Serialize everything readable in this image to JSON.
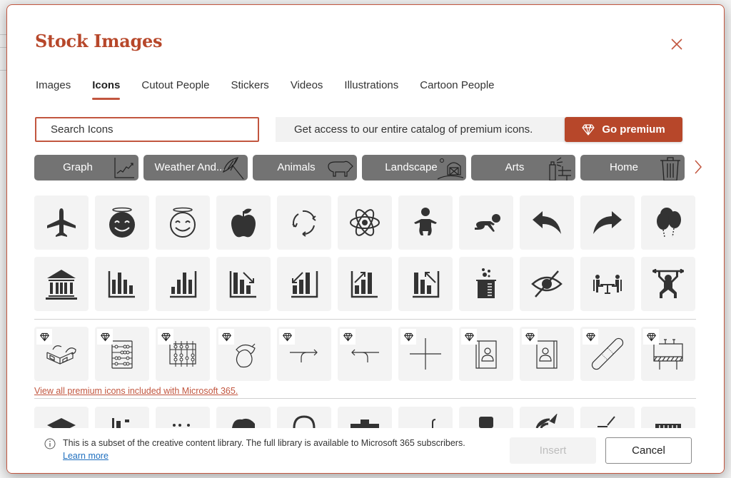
{
  "dialog": {
    "title": "Stock Images",
    "close_label": "Close"
  },
  "tabs": [
    {
      "label": "Images",
      "active": false
    },
    {
      "label": "Icons",
      "active": true
    },
    {
      "label": "Cutout People",
      "active": false
    },
    {
      "label": "Stickers",
      "active": false
    },
    {
      "label": "Videos",
      "active": false
    },
    {
      "label": "Illustrations",
      "active": false
    },
    {
      "label": "Cartoon People",
      "active": false
    }
  ],
  "search": {
    "placeholder": "Search Icons",
    "value": ""
  },
  "promo": {
    "text": "Get access to our entire catalog of premium icons.",
    "button_label": "Go premium",
    "button_icon": "diamond-icon"
  },
  "categories": [
    {
      "label": "Graph",
      "icon": "line-graph-icon"
    },
    {
      "label": "Weather And...",
      "icon": "umbrella-icon"
    },
    {
      "label": "Animals",
      "icon": "pig-icon"
    },
    {
      "label": "Landscape",
      "icon": "barn-icon"
    },
    {
      "label": "Arts",
      "icon": "spray-paint-icon"
    },
    {
      "label": "Home",
      "icon": "trash-can-icon"
    }
  ],
  "free_icons": [
    [
      {
        "name": "airplane"
      },
      {
        "name": "smiling-face-with-halo-filled"
      },
      {
        "name": "smiling-face-with-halo-outline"
      },
      {
        "name": "apple"
      },
      {
        "name": "refresh-arrows"
      },
      {
        "name": "atom"
      },
      {
        "name": "baby"
      },
      {
        "name": "crawling-baby"
      },
      {
        "name": "reply-arrow"
      },
      {
        "name": "forward-arrow"
      },
      {
        "name": "balloons"
      }
    ],
    [
      {
        "name": "bank"
      },
      {
        "name": "bar-chart"
      },
      {
        "name": "bar-chart-ascending"
      },
      {
        "name": "bar-chart-downward-trend"
      },
      {
        "name": "bar-chart-arrow-down-left"
      },
      {
        "name": "bar-chart-upward-trend"
      },
      {
        "name": "bar-chart-upward-trend-2"
      },
      {
        "name": "bar-chart-arrow-up-left"
      },
      {
        "name": "beaker"
      },
      {
        "name": "hide-eye"
      },
      {
        "name": "meeting-table"
      },
      {
        "name": "weightlifter"
      }
    ]
  ],
  "premium_icons": [
    {
      "name": "3d-glasses"
    },
    {
      "name": "abacus"
    },
    {
      "name": "abacus-2"
    },
    {
      "name": "acorn"
    },
    {
      "name": "arrow-curve-right"
    },
    {
      "name": "arrow-curve-left"
    },
    {
      "name": "crosshair-plus"
    },
    {
      "name": "address-book"
    },
    {
      "name": "address-book-2"
    },
    {
      "name": "bandage"
    },
    {
      "name": "billboard"
    }
  ],
  "premium_link": "View all premium icons included with Microsoft 365.",
  "partial_icons": [
    {
      "name": "graduation-cap"
    },
    {
      "name": "bar-chart-small"
    },
    {
      "name": "dots"
    },
    {
      "name": "brain"
    },
    {
      "name": "badge"
    },
    {
      "name": "briefcase"
    },
    {
      "name": "hook"
    },
    {
      "name": "bus"
    },
    {
      "name": "target"
    },
    {
      "name": "check"
    },
    {
      "name": "ruler"
    }
  ],
  "footer": {
    "info_text": "This is a subset of the creative content library. The full library is available to Microsoft 365 subscribers.",
    "learn_more": "Learn more",
    "insert_label": "Insert",
    "cancel_label": "Cancel"
  },
  "colors": {
    "accent": "#b7472a",
    "category_bg": "#737373",
    "tile_bg": "#f3f3f3",
    "link_blue": "#1f6fbf"
  }
}
